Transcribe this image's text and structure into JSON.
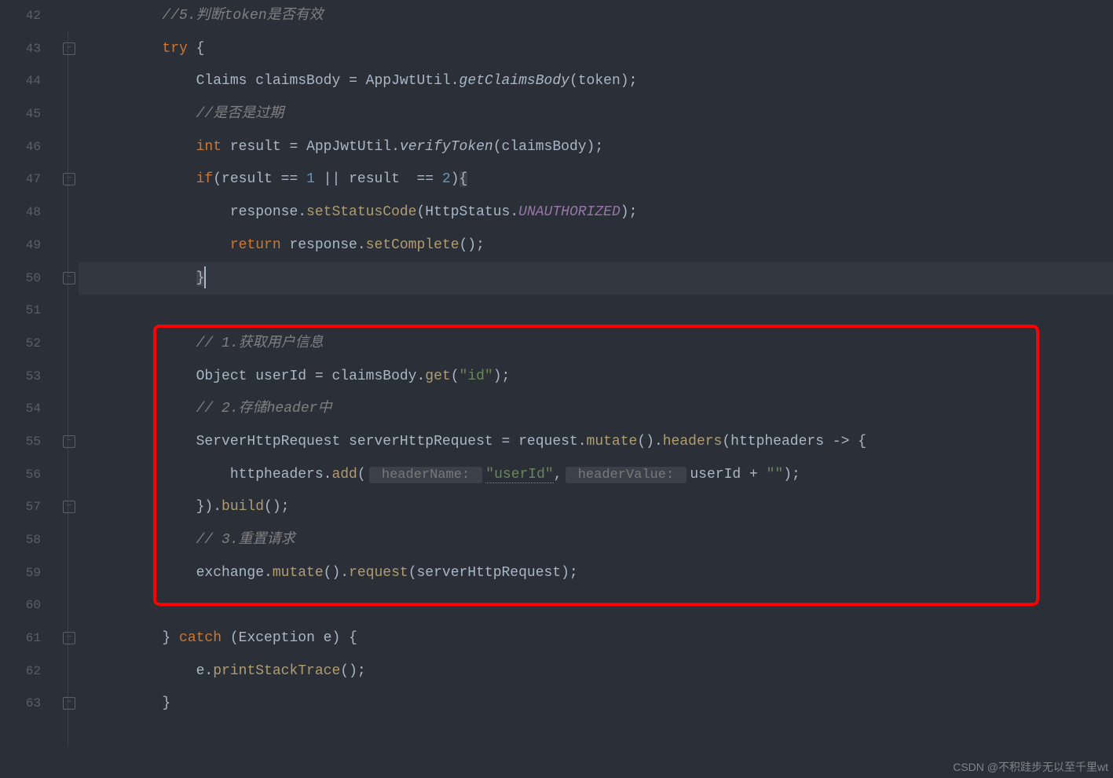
{
  "lines": [
    42,
    43,
    44,
    45,
    46,
    47,
    48,
    49,
    50,
    51,
    52,
    53,
    54,
    55,
    56,
    57,
    58,
    59,
    60,
    61,
    62,
    63
  ],
  "code": {
    "l42": "//5.判断token是否有效",
    "l43_try": "try",
    "l43_brace": " {",
    "l44_type": "Claims",
    "l44_var": " claimsBody",
    "l44_eq": " = ",
    "l44_cls": "AppJwtUtil",
    "l44_dot": ".",
    "l44_m": "getClaimsBody",
    "l44_args": "(token);",
    "l45": "//是否是过期",
    "l46_type": "int",
    "l46_var": " result",
    "l46_eq": " = ",
    "l46_cls": "AppJwtUtil",
    "l46_dot": ".",
    "l46_m": "verifyToken",
    "l46_args": "(claimsBody);",
    "l47_if": "if",
    "l47_cond1": "(result == ",
    "l47_n1": "1",
    "l47_or": " || ",
    "l47_cond2": "result  == ",
    "l47_n2": "2",
    "l47_close": ")",
    "l47_brace": "{",
    "l48_obj": "response.",
    "l48_m": "setStatusCode",
    "l48_p1": "(",
    "l48_cls": "HttpStatus",
    "l48_dot": ".",
    "l48_c": "UNAUTHORIZED",
    "l48_p2": ");",
    "l49_ret": "return",
    "l49_sp": " response.",
    "l49_m": "setComplete",
    "l49_p": "();",
    "l50_brace": "}",
    "l52": "// 1.获取用户信息",
    "l53_type": "Object",
    "l53_var": " userId",
    "l53_eq": " = ",
    "l53_obj": "claimsBody.",
    "l53_m": "get",
    "l53_p1": "(",
    "l53_s": "\"id\"",
    "l53_p2": ");",
    "l54": "// 2.存储header中",
    "l55_type": "ServerHttpRequest",
    "l55_var": " serverHttpRequest",
    "l55_eq": " = ",
    "l55_obj": "request.",
    "l55_m1": "mutate",
    "l55_d1": "().",
    "l55_m2": "headers",
    "l55_p": "(httpheaders -> {",
    "l56_obj": "httpheaders.",
    "l56_m": "add",
    "l56_p1": "(",
    "l56_h1": " headerName: ",
    "l56_s1": "\"userId\"",
    "l56_c": ",",
    "l56_h2": " headerValue: ",
    "l56_id": "userId",
    "l56_plus": " + ",
    "l56_s2": "\"\"",
    "l56_p2": ");",
    "l57_close": "}).",
    "l57_m": "build",
    "l57_p": "();",
    "l58": "// 3.重置请求",
    "l59_obj": "exchange.",
    "l59_m1": "mutate",
    "l59_d1": "().",
    "l59_m2": "request",
    "l59_args": "(serverHttpRequest);",
    "l61_close": "} ",
    "l61_catch": "catch",
    "l61_p": " (Exception e) {",
    "l62_obj": "e.",
    "l62_m": "printStackTrace",
    "l62_p": "();",
    "l63_brace": "}"
  },
  "watermark": "CSDN @不积跬步无以至千里wt"
}
